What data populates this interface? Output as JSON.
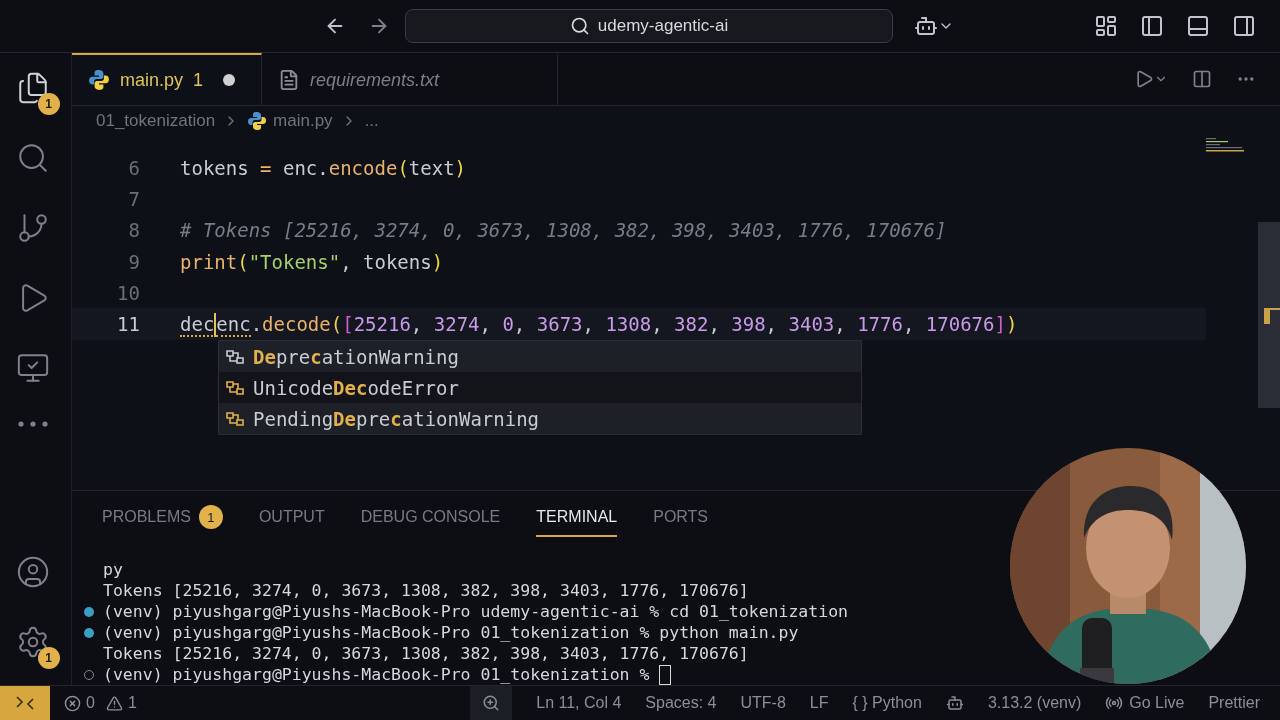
{
  "title_bar": {
    "search": "udemy-agentic-ai"
  },
  "activity_bar": {
    "top": [
      {
        "kind": "explorer",
        "badge": "1",
        "selected": true
      },
      {
        "kind": "search",
        "selected": false
      },
      {
        "kind": "source-control",
        "selected": false
      },
      {
        "kind": "run-debug",
        "selected": false
      },
      {
        "kind": "remote",
        "selected": false
      },
      {
        "kind": "more",
        "selected": false
      }
    ],
    "bottom": [
      {
        "kind": "account"
      },
      {
        "kind": "settings",
        "badge": "1"
      }
    ]
  },
  "tabs": [
    {
      "label": "main.py",
      "problems": "1",
      "modified": true,
      "selected": true,
      "kind": "python"
    },
    {
      "label": "requirements.txt",
      "modified": false,
      "selected": false,
      "kind": "text"
    }
  ],
  "breadcrumb": [
    {
      "label": "01_tokenization",
      "kind": "folder"
    },
    {
      "label": "main.py",
      "kind": "python"
    },
    {
      "label": "...",
      "kind": "more"
    }
  ],
  "editor": {
    "lines": [
      {
        "number": "6",
        "active": false,
        "tokens": [
          {
            "text": "tokens ",
            "kind": "plain"
          },
          {
            "text": "=",
            "kind": "operator"
          },
          {
            "text": " enc.",
            "kind": "plain"
          },
          {
            "text": "encode",
            "kind": "function"
          },
          {
            "text": "(",
            "kind": "paren"
          },
          {
            "text": "text",
            "kind": "plain"
          },
          {
            "text": ")",
            "kind": "paren"
          }
        ]
      },
      {
        "number": "7",
        "active": false
      },
      {
        "number": "8",
        "active": false,
        "tokens": [
          {
            "text": "# Tokens [25216, 3274, 0, 3673, 1308, 382, 398, 3403, 1776, 170676]",
            "kind": "comment"
          }
        ]
      },
      {
        "number": "9",
        "active": false,
        "tokens": [
          {
            "text": "print",
            "kind": "function"
          },
          {
            "text": "(",
            "kind": "paren"
          },
          {
            "text": "\"Tokens\"",
            "kind": "string"
          },
          {
            "text": ", tokens",
            "kind": "plain"
          },
          {
            "text": ")",
            "kind": "paren"
          }
        ]
      },
      {
        "number": "10",
        "active": false
      },
      {
        "number": "11",
        "active": true,
        "tokens": [
          {
            "text": "dec",
            "kind": "plain",
            "squiggle": true,
            "cursor_after": true
          },
          {
            "text": "enc",
            "kind": "plain",
            "squiggle": true
          },
          {
            "text": ".",
            "kind": "plain"
          },
          {
            "text": "decode",
            "kind": "function"
          },
          {
            "text": "(",
            "kind": "paren"
          },
          {
            "text": "[",
            "kind": "bracket"
          },
          {
            "text": "25216",
            "kind": "number"
          },
          {
            "text": ", ",
            "kind": "plain"
          },
          {
            "text": "3274",
            "kind": "number"
          },
          {
            "text": ", ",
            "kind": "plain"
          },
          {
            "text": "0",
            "kind": "number"
          },
          {
            "text": ", ",
            "kind": "plain"
          },
          {
            "text": "3673",
            "kind": "number"
          },
          {
            "text": ", ",
            "kind": "plain"
          },
          {
            "text": "1308",
            "kind": "number"
          },
          {
            "text": ", ",
            "kind": "plain"
          },
          {
            "text": "382",
            "kind": "number"
          },
          {
            "text": ", ",
            "kind": "plain"
          },
          {
            "text": "398",
            "kind": "number"
          },
          {
            "text": ", ",
            "kind": "plain"
          },
          {
            "text": "3403",
            "kind": "number"
          },
          {
            "text": ", ",
            "kind": "plain"
          },
          {
            "text": "1776",
            "kind": "number"
          },
          {
            "text": ", ",
            "kind": "plain"
          },
          {
            "text": "170676",
            "kind": "number"
          },
          {
            "text": "]",
            "kind": "bracket"
          },
          {
            "text": ")",
            "kind": "paren"
          }
        ]
      }
    ],
    "suggestions": [
      {
        "label": "**De**pre**c**ationWarning",
        "selected": false
      },
      {
        "label": "Unicode**Dec**odeError",
        "selected": true
      },
      {
        "label": "Pending**De**pre**c**ationWarning",
        "selected": false
      }
    ]
  },
  "panel": {
    "tabs": [
      {
        "label": "PROBLEMS",
        "badge": "1",
        "selected": false
      },
      {
        "label": "OUTPUT",
        "selected": false
      },
      {
        "label": "DEBUG CONSOLE",
        "selected": false
      },
      {
        "label": "TERMINAL",
        "selected": true
      },
      {
        "label": "PORTS",
        "selected": false
      }
    ],
    "terminal": [
      {
        "text": "py",
        "kind": "output",
        "cursor": false
      },
      {
        "text": "Tokens [25216, 3274, 0, 3673, 1308, 382, 398, 3403, 1776, 170676]",
        "kind": "output",
        "cursor": false
      },
      {
        "text": "(venv) piyushgarg@Piyushs-MacBook-Pro udemy-agentic-ai % cd 01_tokenization",
        "kind": "command",
        "cursor": false
      },
      {
        "text": "(venv) piyushgarg@Piyushs-MacBook-Pro 01_tokenization % python main.py",
        "kind": "command",
        "cursor": false
      },
      {
        "text": "Tokens [25216, 3274, 0, 3673, 1308, 382, 398, 3403, 1776, 170676]",
        "kind": "output",
        "cursor": false
      },
      {
        "text": "(venv) piyushgarg@Piyushs-MacBook-Pro 01_tokenization % ",
        "kind": "prompt",
        "cursor": true
      }
    ]
  },
  "status_bar": {
    "errors": "0",
    "warnings": "1",
    "items": [
      {
        "kind": "zoom"
      },
      {
        "kind": "text",
        "text": "Ln 11, Col 4"
      },
      {
        "kind": "text",
        "text": "Spaces: 4"
      },
      {
        "kind": "text",
        "text": "UTF-8"
      },
      {
        "kind": "text",
        "text": "LF"
      },
      {
        "kind": "text",
        "text": "{ }  Python"
      },
      {
        "kind": "copilot"
      },
      {
        "kind": "text",
        "text": "3.13.2 (venv)"
      },
      {
        "kind": "live",
        "text": "Go Live"
      },
      {
        "kind": "text",
        "text": "Prettier"
      }
    ]
  }
}
